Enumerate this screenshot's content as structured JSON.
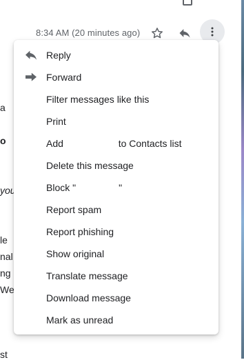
{
  "header": {
    "timestamp": "8:34 AM (20 minutes ago)",
    "icons": [
      "star-icon",
      "reply-icon",
      "more-vert-icon"
    ]
  },
  "background_text": {
    "line1": "a",
    "line2": "o",
    "line3": "you",
    "line4": "le",
    "line5": "nal",
    "line6": "ng",
    "line7": "We",
    "line8": "st"
  },
  "menu": {
    "items": [
      {
        "label": "Reply",
        "icon": "reply-icon"
      },
      {
        "label": "Forward",
        "icon": "forward-icon"
      },
      {
        "label": "Filter messages like this"
      },
      {
        "label": "Print"
      },
      {
        "label_prefix": "Add",
        "label_suffix": "to Contacts list"
      },
      {
        "label": "Delete this message"
      },
      {
        "label_prefix": "Block \"",
        "label_suffix": "\""
      },
      {
        "label": "Report spam"
      },
      {
        "label": "Report phishing"
      },
      {
        "label": "Show original"
      },
      {
        "label": "Translate message"
      },
      {
        "label": "Download message"
      },
      {
        "label": "Mark as unread"
      }
    ]
  }
}
